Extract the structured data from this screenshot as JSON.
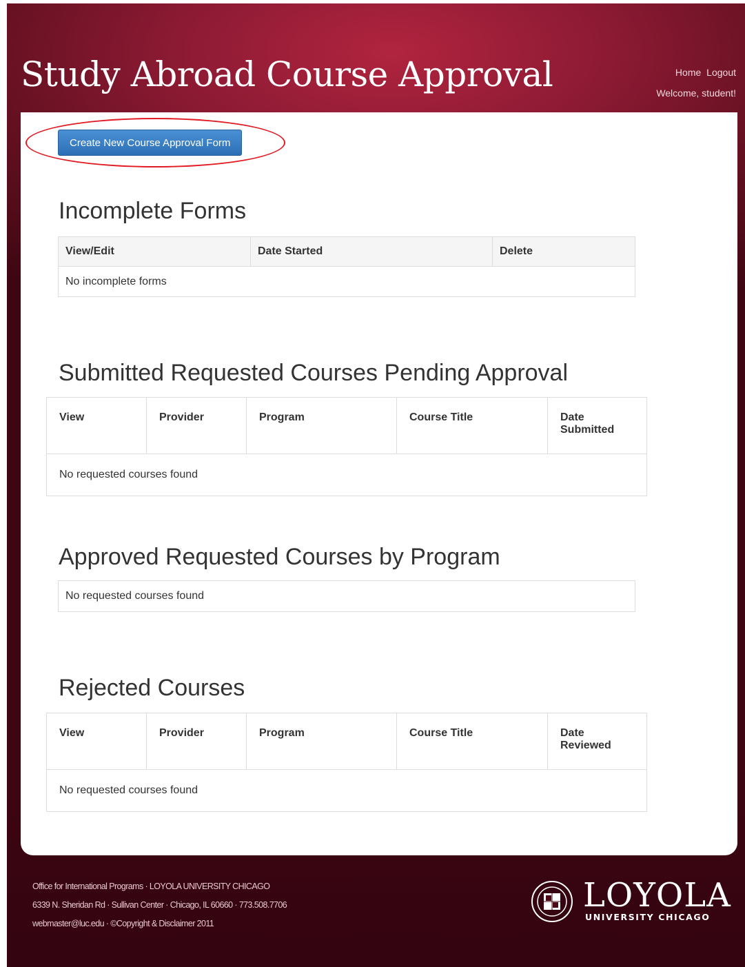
{
  "header": {
    "title": "Study Abroad Course Approval",
    "nav": [
      "Home",
      "Logout"
    ],
    "welcome": "Welcome, student!"
  },
  "actions": {
    "create_label": "Create New Course Approval Form"
  },
  "incomplete": {
    "title": "Incomplete Forms",
    "columns": [
      "View/Edit",
      "Date Started",
      "Delete"
    ],
    "empty": "No incomplete forms"
  },
  "pending": {
    "title": "Submitted Requested Courses Pending Approval",
    "columns": [
      "View",
      "Provider",
      "Program",
      "Course Title",
      "Date Submitted"
    ],
    "empty": "No requested courses found"
  },
  "approved": {
    "title": "Approved Requested Courses by Program",
    "empty": "No requested courses found"
  },
  "rejected": {
    "title": "Rejected Courses",
    "columns": [
      "View",
      "Provider",
      "Program",
      "Course Title",
      "Date Reviewed"
    ],
    "empty": "No requested courses found"
  },
  "footer": {
    "lines": [
      "Office for International Programs  ·  LOYOLA UNIVERSITY CHICAGO",
      "6339 N. Sheridan Rd  ·  Sullivan Center  ·  Chicago, IL 60660  ·  773.508.7706",
      "webmaster@luc.edu  ·  ©Copyright & Disclaimer 2011"
    ],
    "logo_word": "LOYOLA",
    "logo_sub": "UNIVERSITY CHICAGO"
  }
}
